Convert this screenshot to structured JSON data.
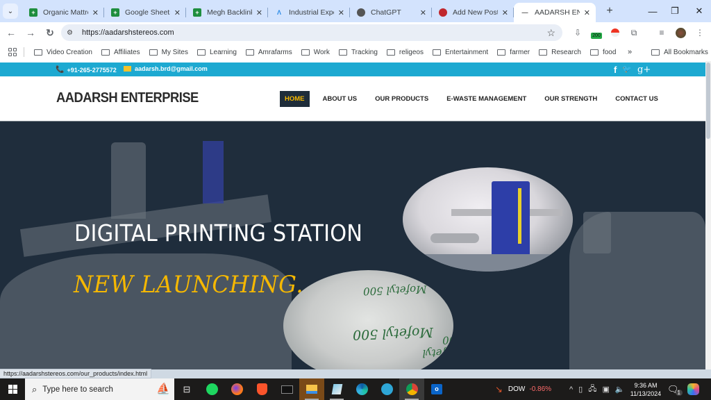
{
  "browser": {
    "tabs": [
      {
        "title": "Organic Mattres",
        "icon": "google-sheets-icon",
        "color": "#1e8e3e",
        "active": false
      },
      {
        "title": "Google Sheets",
        "icon": "google-sheets-icon",
        "color": "#1e8e3e",
        "active": false
      },
      {
        "title": "Megh Backlinks",
        "icon": "google-sheets-icon",
        "color": "#1e8e3e",
        "active": false
      },
      {
        "title": "Industrial Experi",
        "icon": "industrial-site-icon",
        "color": "#2b8be6",
        "active": false
      },
      {
        "title": "ChatGPT",
        "icon": "chatgpt-icon",
        "color": "#555555",
        "active": false
      },
      {
        "title": "Add New Post",
        "icon": "wordpress-red-icon",
        "color": "#c0272d",
        "active": false
      },
      {
        "title": "AADARSH ENTER",
        "icon": "dash-icon",
        "color": "#555555",
        "active": true
      }
    ],
    "close_glyph": "✕",
    "new_tab_glyph": "+",
    "url": "https://aadarshstereos.com",
    "extension_badge": "200",
    "bookmarks": [
      "Video Creation",
      "Affiliates",
      "My Sites",
      "Learning",
      "Amrafarms",
      "Work",
      "Tracking",
      "religeos",
      "Entertainment",
      "farmer",
      "Research",
      "food"
    ],
    "more_bookmarks": "»",
    "all_bookmarks": "All Bookmarks",
    "status_url": "https://aadarshstereos.com/our_products/index.html"
  },
  "site": {
    "phone": "+91-265-2775572",
    "email": "aadarsh.brd@gmail.com",
    "social": [
      "f",
      "🐦",
      "g+"
    ],
    "logo": "AADARSH ENTERPRISE",
    "nav": [
      {
        "label": "HOME",
        "active": true
      },
      {
        "label": "ABOUT US",
        "active": false
      },
      {
        "label": "OUR PRODUCTS",
        "active": false
      },
      {
        "label": "E-WASTE MANAGEMENT",
        "active": false
      },
      {
        "label": "OUR STRENGTH",
        "active": false
      },
      {
        "label": "CONTACT US",
        "active": false
      }
    ],
    "hero_title": "DIGITAL PRINTING STATION",
    "hero_subtitle": "NEW LAUNCHING....",
    "pill_text": "Mofetyl 500",
    "colors": {
      "topbar": "#1da9d1",
      "accent": "#f6b800",
      "hero_bg": "#1f2d3c",
      "nav_active_bg": "#1f2d3a"
    }
  },
  "taskbar": {
    "search_placeholder": "Type here to search",
    "ticker": "DOW",
    "ticker_change": "-0.86%",
    "time": "9:36 AM",
    "date": "11/13/2024",
    "notification_count": "1"
  }
}
